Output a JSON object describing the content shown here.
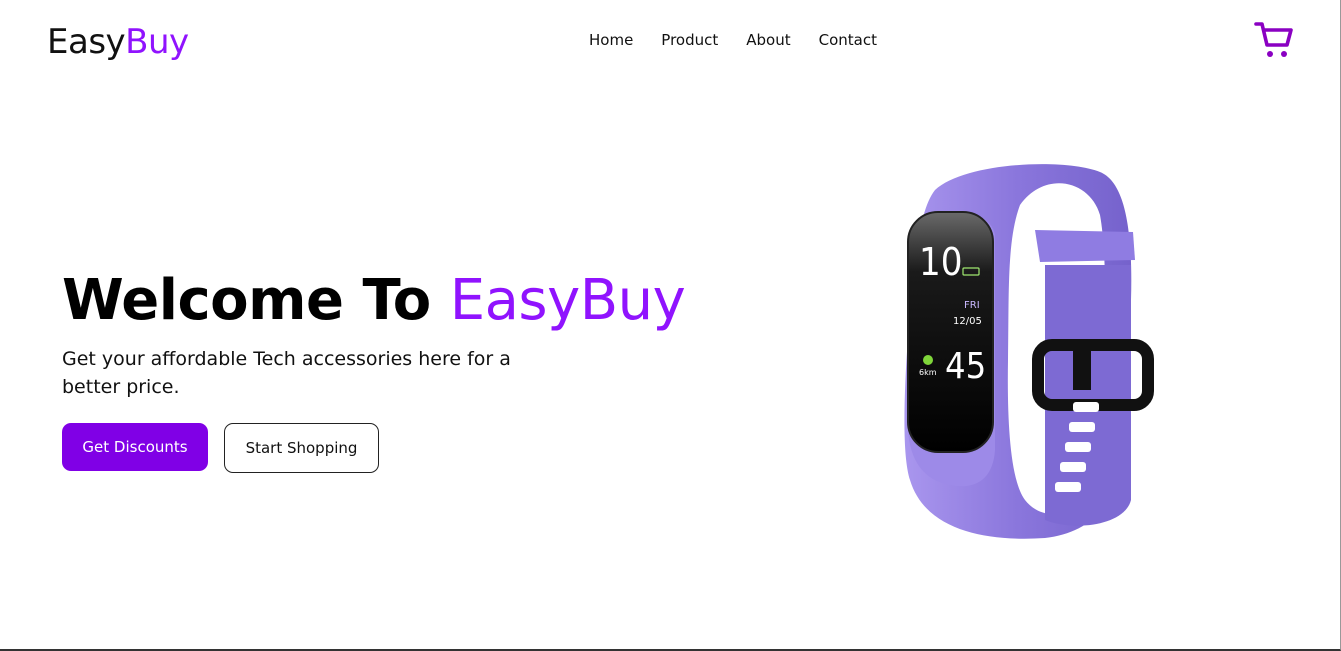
{
  "header": {
    "logo_part1": "Easy",
    "logo_part2": "Buy",
    "nav": [
      "Home",
      "Product",
      "About",
      "Contact"
    ],
    "cart_icon": "cart-icon"
  },
  "hero": {
    "title_part1": "Welcome To ",
    "title_part2": "EasyBuy",
    "subtitle": "Get your affordable Tech accessories here for a better price.",
    "primary_button": "Get Discounts",
    "secondary_button": "Start Shopping"
  },
  "product_image": {
    "screen_time_hour": "10",
    "screen_day": "FRI",
    "screen_date": "12/05",
    "screen_minutes": "45",
    "screen_distance": "6km"
  },
  "colors": {
    "accent": "#9013fe",
    "button_bg": "#8000e6",
    "band": "#8b78e0"
  }
}
